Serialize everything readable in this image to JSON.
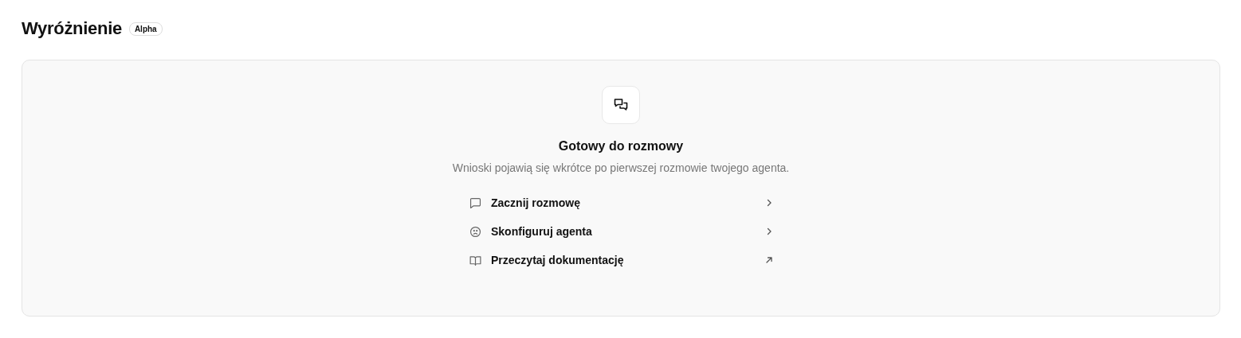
{
  "header": {
    "title": "Wyróżnienie",
    "badge": "Alpha"
  },
  "empty_state": {
    "title": "Gotowy do rozmowy",
    "description": "Wnioski pojawią się wkrótce po pierwszej rozmowie twojego agenta.",
    "actions": [
      {
        "kind": "chat",
        "label": "Zacznij rozmowę",
        "external": false
      },
      {
        "kind": "agent",
        "label": "Skonfiguruj agenta",
        "external": false
      },
      {
        "kind": "docs",
        "label": "Przeczytaj dokumentację",
        "external": true
      }
    ]
  }
}
